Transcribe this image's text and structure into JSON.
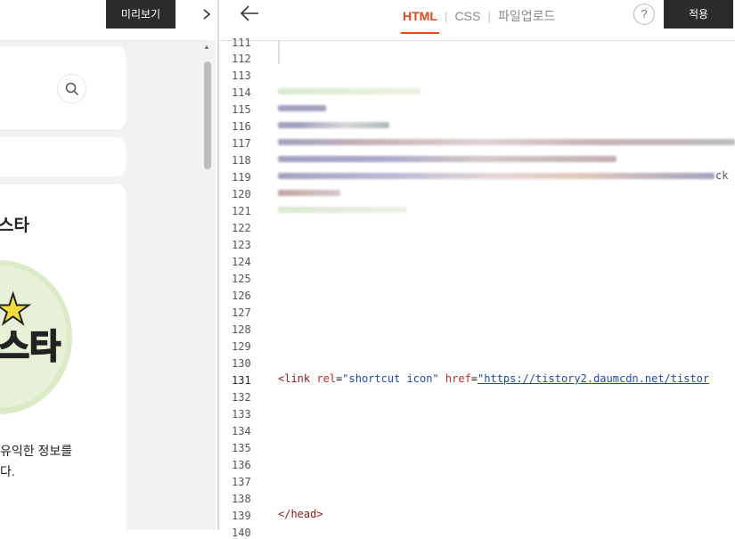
{
  "preview": {
    "preview_button": "미리보기",
    "collapse_icon": "chevron-right-icon",
    "search_icon": "search-icon",
    "card_title_fragment": "스타",
    "logo_text": "스타",
    "description": "유익한 정보를\n다."
  },
  "editor": {
    "back_icon": "arrow-left-icon",
    "tabs": [
      "HTML",
      "CSS",
      "파일업로드"
    ],
    "active_tab": "HTML",
    "help_label": "?",
    "apply_button": "적용",
    "line_numbers": [
      "111",
      "112",
      "113",
      "114",
      "115",
      "116",
      "117",
      "118",
      "119",
      "120",
      "121",
      "122",
      "123",
      "124",
      "125",
      "126",
      "127",
      "128",
      "129",
      "130",
      "131",
      "132",
      "133",
      "134",
      "135",
      "136",
      "137",
      "138",
      "139",
      "140"
    ],
    "active_line": "131",
    "line131": {
      "open": "<link ",
      "rel_attr": "rel",
      "rel_val": "\"shortcut icon\"",
      "href_attr": "href",
      "href_val": "\"https://tistory2.daumcdn.net/tistor"
    },
    "line139": "</head>",
    "line119_tail": "ck"
  },
  "colors": {
    "accent": "#e8461a",
    "dark_button": "#2b2b2b"
  }
}
